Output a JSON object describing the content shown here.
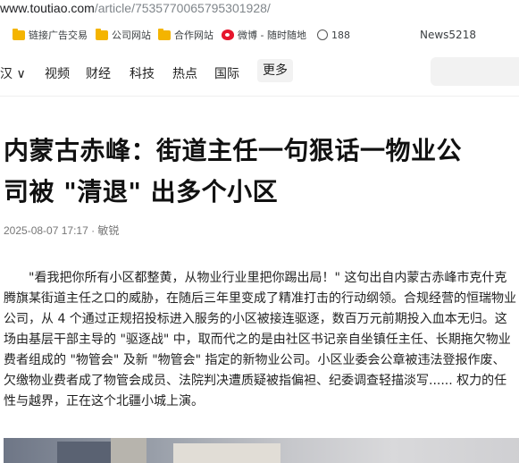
{
  "browser": {
    "url_host": "www.toutiao.com",
    "url_path": "/article/7535770065795301928/"
  },
  "bookmarks": [
    {
      "label": "链接广告交易",
      "icon": "folder-icon"
    },
    {
      "label": "公司网站",
      "icon": "folder-icon"
    },
    {
      "label": "合作网站",
      "icon": "folder-icon"
    },
    {
      "label": "微博 - 随时随地",
      "icon": "weibo-icon"
    },
    {
      "label": "188",
      "icon": "globe-icon"
    },
    {
      "label": "News5218",
      "icon": ""
    }
  ],
  "nav": {
    "location": "汉 ∨",
    "items": [
      "视频",
      "财经",
      "科技",
      "热点",
      "国际"
    ],
    "more": "更多"
  },
  "article": {
    "title_line1": "内蒙古赤峰：街道主任一句狠话一物业公",
    "title_line2": "司被 \"清退\" 出多个小区",
    "date": "2025-08-07 17:17",
    "separator": " · ",
    "author": "敏锐",
    "paragraph": "\"看我把你所有小区都整黄，从物业行业里把你踢出局！\" 这句出自内蒙古赤峰市克什克腾旗某街道主任之口的威胁，在随后三年里变成了精准打击的行动纲领。合规经营的恒瑞物业公司，从 4 个通过正规招投标进入服务的小区被接连驱逐，数百万元前期投入血本无归。这场由基层干部主导的 \"驱逐战\" 中，取而代之的是由社区书记亲自坐镇任主任、长期拖欠物业费者组成的 \"物管会\" 及新 \"物管会\" 指定的新物业公司。小区业委会公章被违法登报作废、欠缴物业费者成了物管会成员、法院判决遭质疑被指偏袒、纪委调查轻描淡写...... 权力的任性与越界，正在这个北疆小城上演。"
  }
}
